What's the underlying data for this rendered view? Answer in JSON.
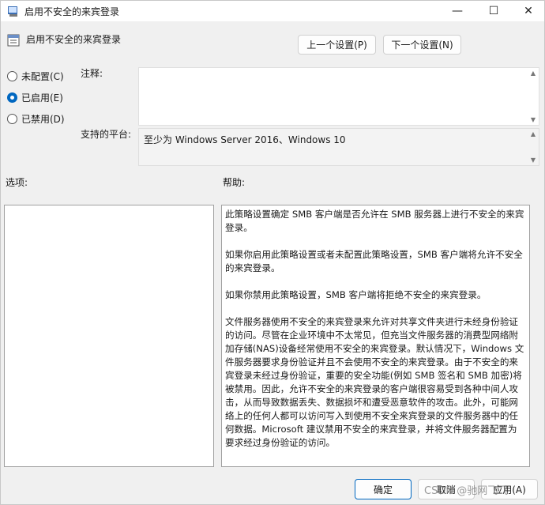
{
  "window": {
    "title": "启用不安全的来宾登录",
    "minimize_glyph": "—",
    "maximize_glyph": "☐",
    "close_glyph": "✕"
  },
  "header": {
    "policy_name": "启用不安全的来宾登录",
    "prev_label": "上一个设置(P)",
    "next_label": "下一个设置(N)"
  },
  "state": {
    "options": [
      {
        "label": "未配置(C)",
        "checked": false
      },
      {
        "label": "已启用(E)",
        "checked": true
      },
      {
        "label": "已禁用(D)",
        "checked": false
      }
    ]
  },
  "comment": {
    "label": "注释:",
    "value": ""
  },
  "platform": {
    "label": "支持的平台:",
    "value": "至少为 Windows Server 2016、Windows 10"
  },
  "sections": {
    "options_label": "选项:",
    "help_label": "帮助:"
  },
  "help": {
    "paragraphs": [
      "此策略设置确定 SMB 客户端是否允许在 SMB 服务器上进行不安全的来宾登录。",
      "如果你启用此策略设置或者未配置此策略设置，SMB 客户端将允许不安全的来宾登录。",
      "如果你禁用此策略设置，SMB 客户端将拒绝不安全的来宾登录。",
      "文件服务器使用不安全的来宾登录来允许对共享文件夹进行未经身份验证的访问。尽管在企业环境中不太常见，但充当文件服务器的消费型网络附加存储(NAS)设备经常使用不安全的来宾登录。默认情况下，Windows 文件服务器要求身份验证并且不会使用不安全的来宾登录。由于不安全的来宾登录未经过身份验证，重要的安全功能(例如 SMB 签名和 SMB 加密)将被禁用。因此，允许不安全的来宾登录的客户端很容易受到各种中间人攻击，从而导致数据丢失、数据损坏和遭受恶意软件的攻击。此外，可能网络上的任何人都可以访问写入到使用不安全来宾登录的文件服务器中的任何数据。Microsoft 建议禁用不安全的来宾登录，并将文件服务器配置为要求经过身份验证的访问。"
    ]
  },
  "footer": {
    "ok_label": "确定",
    "cancel_label": "取消",
    "apply_label": "应用(A)"
  },
  "watermark": "CSDN @驰网飞飞",
  "colors": {
    "accent": "#0067c0",
    "window_bg": "#f0f0f0"
  }
}
